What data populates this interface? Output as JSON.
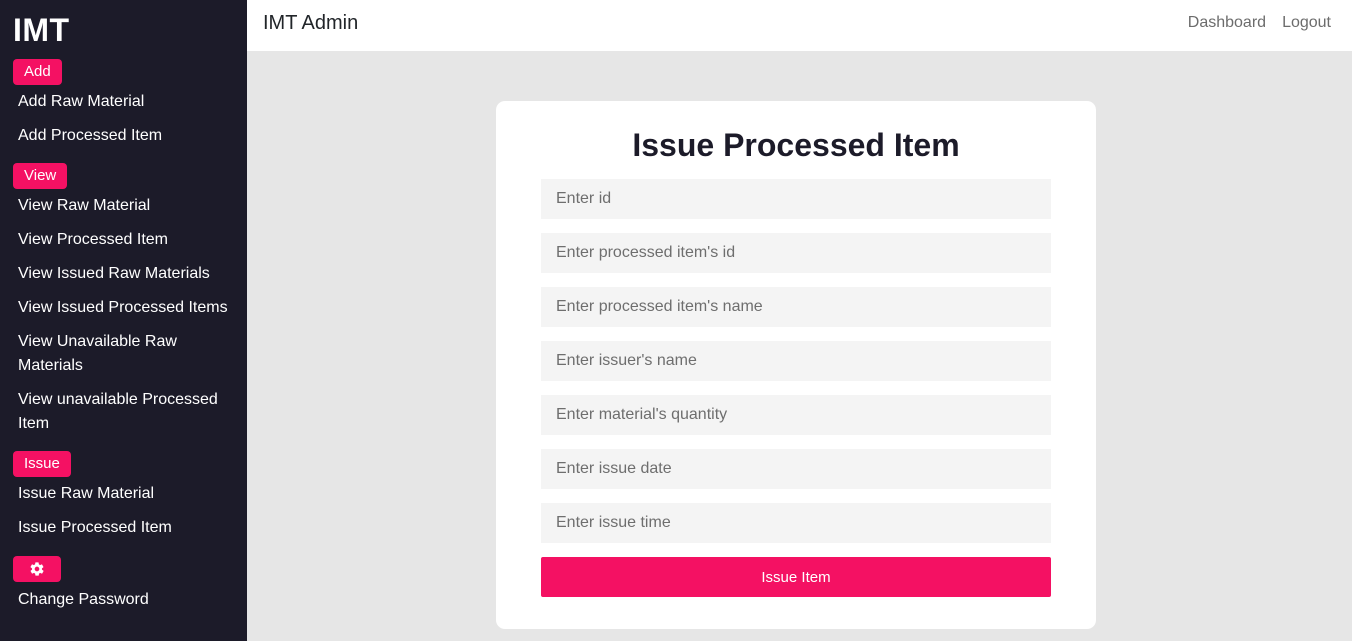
{
  "sidebar": {
    "brand": "IMT",
    "sections": {
      "add": {
        "label": "Add",
        "items": [
          "Add Raw Material",
          "Add Processed Item"
        ]
      },
      "view": {
        "label": "View",
        "items": [
          "View Raw Material",
          "View Processed Item",
          "View Issued Raw Materials",
          "View Issued Processed Items",
          "View Unavailable Raw Materials",
          "View unavailable Processed Item"
        ]
      },
      "issue": {
        "label": "Issue",
        "items": [
          "Issue Raw Material",
          "Issue Processed Item"
        ]
      },
      "settings": {
        "icon": "gear-icon",
        "items": [
          "Change Password"
        ]
      }
    }
  },
  "topbar": {
    "title": "IMT Admin",
    "links": [
      "Dashboard",
      "Logout"
    ]
  },
  "form": {
    "title": "Issue Processed Item",
    "fields": [
      {
        "placeholder": "Enter id",
        "value": ""
      },
      {
        "placeholder": "Enter processed item's id",
        "value": ""
      },
      {
        "placeholder": "Enter processed item's name",
        "value": ""
      },
      {
        "placeholder": "Enter issuer's name",
        "value": ""
      },
      {
        "placeholder": "Enter material's quantity",
        "value": ""
      },
      {
        "placeholder": "Enter issue date",
        "value": ""
      },
      {
        "placeholder": "Enter issue time",
        "value": ""
      }
    ],
    "submit_label": "Issue Item"
  },
  "colors": {
    "accent": "#f41163",
    "sidebar_bg": "#1c1b29",
    "page_bg": "#e6e6e6"
  }
}
